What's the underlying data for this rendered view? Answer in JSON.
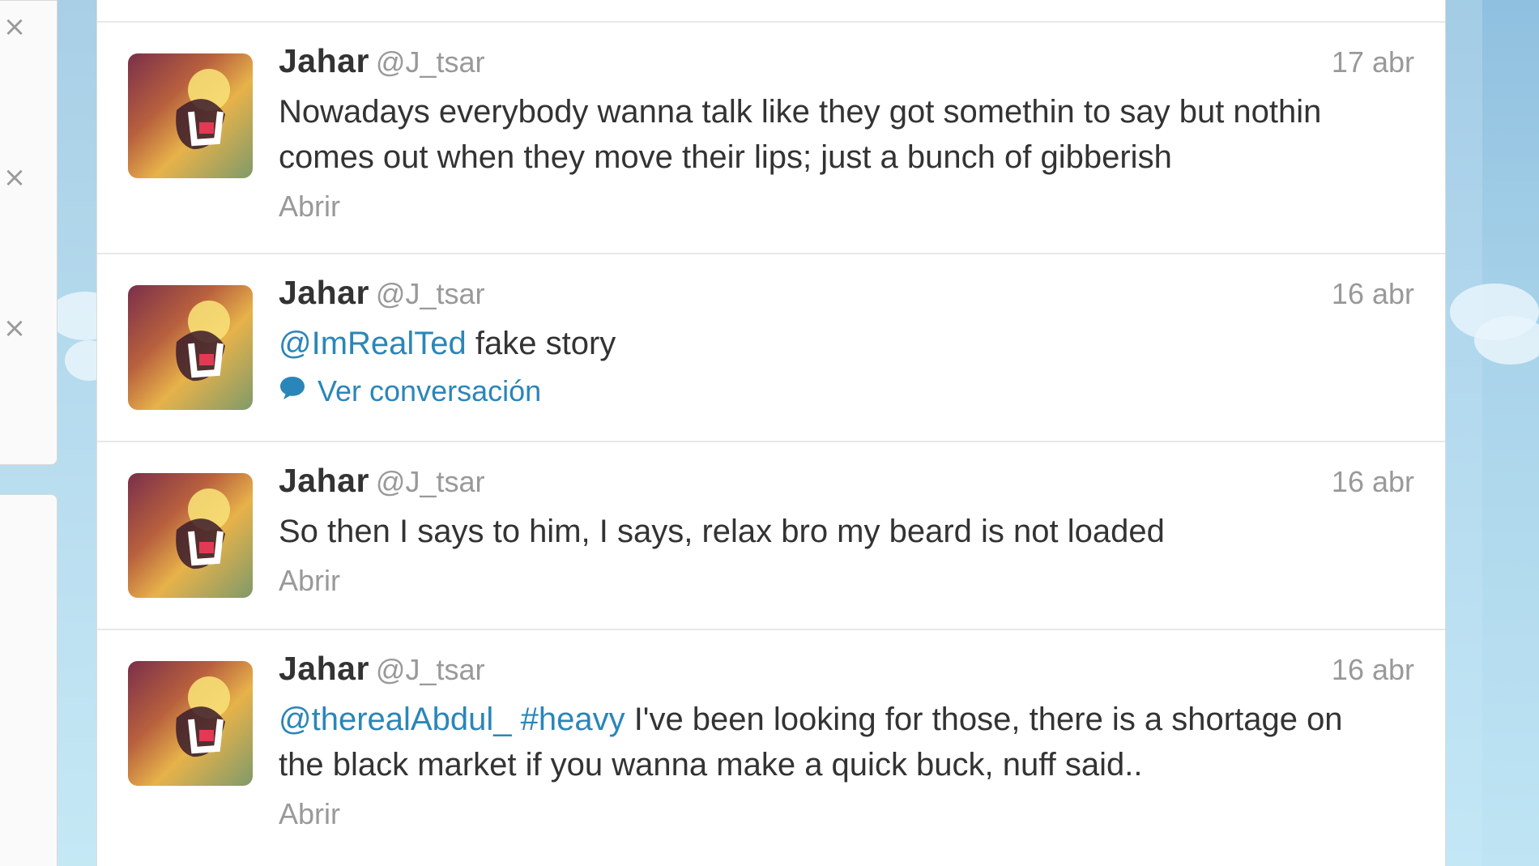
{
  "side_panel": {
    "close_glyph": "×"
  },
  "tweets": [
    {
      "name": "Jahar",
      "handle": "@J_tsar",
      "time": "17 abr",
      "line1": "Nowadays everybody wanna talk like they got somethin to say but nothin",
      "line2": "comes out when they move their lips; just a bunch of gibberish",
      "action": "Abrir"
    },
    {
      "name": "Jahar",
      "handle": "@J_tsar",
      "time": "16 abr",
      "mention": "@ImRealTed",
      "text": " fake story",
      "conversation_label": "Ver conversación",
      "conversation_icon": "speech-bubble-icon"
    },
    {
      "name": "Jahar",
      "handle": "@J_tsar",
      "time": "16 abr",
      "text": "So then I says to him, I says, relax bro my beard is not loaded",
      "action": "Abrir"
    },
    {
      "name": "Jahar",
      "handle": "@J_tsar",
      "time": "16 abr",
      "mention": "@therealAbdul_",
      "hashtag": "#heavy",
      "line1_rest": " I've been looking for those, there is a shortage on",
      "line2": "the black market if you wanna make a quick buck, nuff said..",
      "action": "Abrir"
    }
  ],
  "colors": {
    "link": "#2a86b9",
    "meta": "#999999",
    "text": "#333333"
  }
}
